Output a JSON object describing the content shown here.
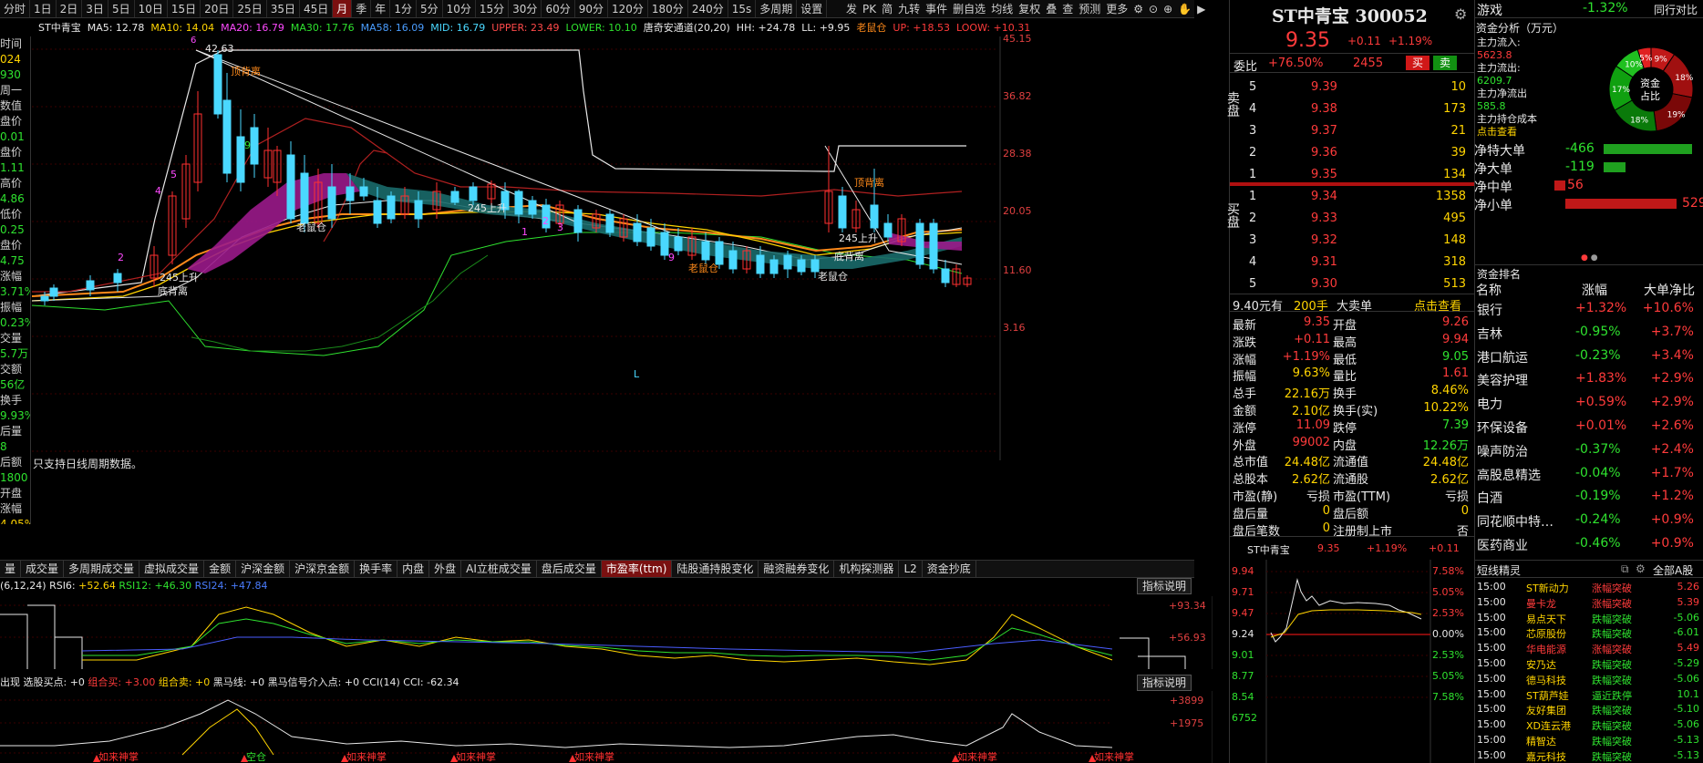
{
  "toolbar": {
    "periods": [
      "分时",
      "1日",
      "2日",
      "3日",
      "5日",
      "10日",
      "15日",
      "20日",
      "25日",
      "35日",
      "45日",
      "月",
      "季",
      "年",
      "1分",
      "5分",
      "10分",
      "15分",
      "30分",
      "60分",
      "90分",
      "120分",
      "180分",
      "240分",
      "15s",
      "多周期",
      "设置"
    ],
    "active_period": "月",
    "right_buttons": [
      "发",
      "PK",
      "简",
      "九转",
      "事件",
      "删自选",
      "均线",
      "复权",
      "叠",
      "查",
      "预测",
      "更多"
    ]
  },
  "ma_line": {
    "stock": "ST中青宝",
    "items": [
      {
        "text": "MA5: 12.78",
        "color": "#e8e8e8"
      },
      {
        "text": "MA10: 14.04",
        "color": "#ffd400"
      },
      {
        "text": "MA20: 16.79",
        "color": "#ff4aff"
      },
      {
        "text": "MA30: 17.76",
        "color": "#2fe22f"
      },
      {
        "text": "MA58: 16.09",
        "color": "#4a9dff"
      },
      {
        "text": "MID: 16.79",
        "color": "#4ad8ff"
      },
      {
        "text": "UPPER: 23.49",
        "color": "#ff4a4a"
      },
      {
        "text": "LOWER: 10.10",
        "color": "#2fe22f"
      },
      {
        "text": "唐奇安通道(20,20)",
        "color": "#e8e8e8"
      },
      {
        "text": "HH: +24.78",
        "color": "#e8e8e8"
      },
      {
        "text": "LL: +9.95",
        "color": "#e8e8e8"
      },
      {
        "text": "老鼠仓",
        "color": "#ff8a1a"
      },
      {
        "text": "UP: +18.53",
        "color": "#ff3b3b"
      },
      {
        "text": "LOOW: +10.31",
        "color": "#ff3b3b"
      }
    ]
  },
  "left_info": [
    "时间",
    "024",
    "930",
    "周一",
    "数值",
    "盘价",
    "0.01",
    "盘价",
    "1.11",
    "高价",
    "4.86",
    "低价",
    "0.25",
    "盘价",
    "4.75",
    "涨幅",
    "3.71%",
    "振幅",
    "0.23%",
    "交量",
    "5.7万",
    "交额",
    "56亿",
    "换手",
    "9.93%",
    "后量",
    "8",
    "后额",
    "1800",
    "开盘",
    "涨幅",
    "4.05%"
  ],
  "price_axis": [
    "45.15",
    "36.82",
    "28.38",
    "20.05",
    "11.60",
    "3.16"
  ],
  "annotations": {
    "high": "42.63",
    "peak_num": "6",
    "note": "只支持日线周期数据。",
    "labels": [
      "顶背离",
      "老鼠仓",
      "底背离",
      "顶背离",
      "老鼠仓",
      "底背离",
      "老鼠仓",
      "245上升",
      "245上升",
      "245上升",
      "L"
    ],
    "nums": [
      "5",
      "4",
      "9",
      "2",
      "1",
      "3",
      "9",
      "2"
    ]
  },
  "bottom_tabs": [
    "量",
    "成交量",
    "多周期成交量",
    "虚拟成交量",
    "金额",
    "沪深金额",
    "沪深京金额",
    "换手率",
    "内盘",
    "外盘",
    "AI立桩成交量",
    "盘后成交量",
    "市盈率(ttm)",
    "陆股通持股变化",
    "融资融券变化",
    "机构探测器",
    "L2",
    "资金抄底"
  ],
  "active_tab": "市盈率(ttm)",
  "rsi": {
    "label": "(6,12,24) RSI6:",
    "rsi6": "+52.64",
    "rsi12_label": "RSI12:",
    "rsi12": "+46.30",
    "rsi24_label": "RSI24:",
    "rsi24": "+47.84",
    "explain_btn": "指标说明",
    "axis": [
      "+93.34",
      "+56.93"
    ]
  },
  "cci": {
    "prefix": "出现",
    "items": [
      {
        "text": "选股买点: +0",
        "color": "#e8e8e8"
      },
      {
        "text": "组合买: +3.00",
        "color": "#ff3b3b"
      },
      {
        "text": "组合卖: +0",
        "color": "#ffd400"
      },
      {
        "text": "黑马线: +0",
        "color": "#e8e8e8"
      },
      {
        "text": "黑马信号介入点: +0",
        "color": "#e8e8e8"
      },
      {
        "text": "CCI(14) CCI: -62.34",
        "color": "#e8e8e8"
      }
    ],
    "explain_btn": "指标说明",
    "axis": [
      "+3899",
      "+1975"
    ],
    "signals": [
      "如来神掌",
      "空仓",
      "如来神掌",
      "如来神掌",
      "如来神掌",
      "如来神掌",
      "如来神掌"
    ]
  },
  "quote": {
    "name": "ST中青宝",
    "code": "300052",
    "price": "9.35",
    "change": "+0.11",
    "change_pct": "+1.19%",
    "weibi_label": "委比",
    "weibi": "+76.50%",
    "weicha": "2455",
    "buy_btn": "买",
    "sell_btn": "卖",
    "sell_label": "卖盘",
    "buy_label": "买盘",
    "sells": [
      {
        "lvl": "5",
        "price": "9.39",
        "vol": "10"
      },
      {
        "lvl": "4",
        "price": "9.38",
        "vol": "173"
      },
      {
        "lvl": "3",
        "price": "9.37",
        "vol": "21"
      },
      {
        "lvl": "2",
        "price": "9.36",
        "vol": "39"
      },
      {
        "lvl": "1",
        "price": "9.35",
        "vol": "134"
      }
    ],
    "buys": [
      {
        "lvl": "1",
        "price": "9.34",
        "vol": "1358"
      },
      {
        "lvl": "2",
        "price": "9.33",
        "vol": "495"
      },
      {
        "lvl": "3",
        "price": "9.32",
        "vol": "148"
      },
      {
        "lvl": "4",
        "price": "9.31",
        "vol": "318"
      },
      {
        "lvl": "5",
        "price": "9.30",
        "vol": "513"
      }
    ],
    "big_order": {
      "price": "9.40元有",
      "qty": "200手",
      "label": "大卖单",
      "link": "点击查看"
    }
  },
  "stats": [
    {
      "l1": "最新",
      "v1": "9.35",
      "c1": "#ff3b3b",
      "l2": "开盘",
      "v2": "9.26",
      "c2": "#ff3b3b"
    },
    {
      "l1": "涨跌",
      "v1": "+0.11",
      "c1": "#ff3b3b",
      "l2": "最高",
      "v2": "9.94",
      "c2": "#ff3b3b"
    },
    {
      "l1": "涨幅",
      "v1": "+1.19%",
      "c1": "#ff3b3b",
      "l2": "最低",
      "v2": "9.05",
      "c2": "#2fe22f"
    },
    {
      "l1": "振幅",
      "v1": "9.63%",
      "c1": "#ffd400",
      "l2": "量比",
      "v2": "1.61",
      "c2": "#ff3b3b"
    },
    {
      "l1": "总手",
      "v1": "22.16万",
      "c1": "#ffd400",
      "l2": "换手",
      "v2": "8.46%",
      "c2": "#ffd400"
    },
    {
      "l1": "金额",
      "v1": "2.10亿",
      "c1": "#ffd400",
      "l2": "换手(实)",
      "v2": "10.22%",
      "c2": "#ffd400"
    },
    {
      "l1": "涨停",
      "v1": "11.09",
      "c1": "#ff3b3b",
      "l2": "跌停",
      "v2": "7.39",
      "c2": "#2fe22f"
    },
    {
      "l1": "外盘",
      "v1": "99002",
      "c1": "#ff3b3b",
      "l2": "内盘",
      "v2": "12.26万",
      "c2": "#2fe22f"
    },
    {
      "l1": "总市值",
      "v1": "24.48亿",
      "c1": "#ffd400",
      "l2": "流通值",
      "v2": "24.48亿",
      "c2": "#ffd400"
    },
    {
      "l1": "总股本",
      "v1": "2.62亿",
      "c1": "#ffd400",
      "l2": "流通股",
      "v2": "2.62亿",
      "c2": "#ffd400"
    },
    {
      "l1": "市盈(静)",
      "v1": "亏损",
      "c1": "#e8e8e8",
      "l2": "市盈(TTM)",
      "v2": "亏损",
      "c2": "#e8e8e8"
    },
    {
      "l1": "盘后量",
      "v1": "0",
      "c1": "#ffd400",
      "l2": "盘后额",
      "v2": "0",
      "c2": "#ffd400"
    },
    {
      "l1": "盘后笔数",
      "v1": "0",
      "c1": "#ffd400",
      "l2": "注册制上市",
      "v2": "否",
      "c2": "#e8e8e8"
    }
  ],
  "mini_chart": {
    "name": "ST中青宝",
    "price": "9.35",
    "pct": "+1.19%",
    "chg": "+0.11",
    "left_axis": [
      "9.94",
      "9.71",
      "9.47",
      "9.24",
      "9.01",
      "8.77",
      "8.54",
      "6752"
    ],
    "right_axis": [
      "7.58%",
      "5.05%",
      "2.53%",
      "0.00%",
      "2.53%",
      "5.05%",
      "7.58%"
    ]
  },
  "sector": {
    "name": "游戏",
    "pct": "-1.32%",
    "button": "同行对比",
    "fund_title": "资金分析（万元）",
    "inflow_label": "主力流入:",
    "inflow": "5623.8",
    "outflow_label": "主力流出:",
    "outflow": "6209.7",
    "net_label": "主力净流出",
    "net": "585.8",
    "cost_label": "主力持仓成本",
    "cost_link": "点击查看",
    "donut_center": [
      "资金",
      "占比"
    ],
    "donut": [
      {
        "label": "9%",
        "value": 9,
        "color": "#c11818"
      },
      {
        "label": "18%",
        "value": 18,
        "color": "#a01010"
      },
      {
        "label": "19%",
        "value": 19,
        "color": "#7a0808"
      },
      {
        "label": "18%",
        "value": 18,
        "color": "#0a7a0a"
      },
      {
        "label": "17%",
        "value": 17,
        "color": "#10a010"
      },
      {
        "label": "10%",
        "value": 10,
        "color": "#20c020"
      },
      {
        "label": "5%",
        "value": 5,
        "color": "#e02020"
      }
    ],
    "flows": [
      {
        "label": "净特大单",
        "value": "-466",
        "color": "#2fe22f",
        "frac": 0.88
      },
      {
        "label": "净大单",
        "value": "-119",
        "color": "#2fe22f",
        "frac": 0.22
      },
      {
        "label": "净中单",
        "value": "56",
        "color": "#ff3b3b",
        "frac": 0.11
      },
      {
        "label": "净小单",
        "value": "529",
        "color": "#ff3b3b",
        "frac": 1.0
      }
    ]
  },
  "ranking": {
    "title": "资金排名",
    "headers": [
      "名称",
      "涨幅",
      "大单净比"
    ],
    "rows": [
      {
        "name": "银行",
        "pct": "+1.32%",
        "net": "+10.6%"
      },
      {
        "name": "吉林",
        "pct": "-0.95%",
        "net": "+3.7%"
      },
      {
        "name": "港口航运",
        "pct": "-0.23%",
        "net": "+3.4%"
      },
      {
        "name": "美容护理",
        "pct": "+1.83%",
        "net": "+2.9%"
      },
      {
        "name": "电力",
        "pct": "+0.59%",
        "net": "+2.9%"
      },
      {
        "name": "环保设备",
        "pct": "+0.01%",
        "net": "+2.6%"
      },
      {
        "name": "噪声防治",
        "pct": "-0.37%",
        "net": "+2.4%"
      },
      {
        "name": "高股息精选",
        "pct": "-0.04%",
        "net": "+1.7%"
      },
      {
        "name": "白酒",
        "pct": "-0.19%",
        "net": "+1.2%"
      },
      {
        "name": "同花顺中特…",
        "pct": "-0.24%",
        "net": "+0.9%"
      },
      {
        "name": "医药商业",
        "pct": "-0.46%",
        "net": "+0.9%"
      }
    ]
  },
  "news": {
    "title": "短线精灵",
    "filter": "全部A股",
    "rows": [
      {
        "time": "15:00",
        "name": "ST新动力",
        "event": "涨幅突破",
        "val": "5.26",
        "color": "#ff3b3b"
      },
      {
        "time": "15:00",
        "name": "曼卡龙",
        "event": "涨幅突破",
        "val": "5.39",
        "color": "#ff3b3b"
      },
      {
        "time": "15:00",
        "name": "易点天下",
        "event": "跌幅突破",
        "val": "-5.06",
        "color": "#2fe22f"
      },
      {
        "time": "15:00",
        "name": "芯原股份",
        "event": "跌幅突破",
        "val": "-6.01",
        "color": "#2fe22f"
      },
      {
        "time": "15:00",
        "name": "华电能源",
        "event": "涨幅突破",
        "val": "5.49",
        "color": "#ff3b3b"
      },
      {
        "time": "15:00",
        "name": "安乃达",
        "event": "跌幅突破",
        "val": "-5.29",
        "color": "#2fe22f"
      },
      {
        "time": "15:00",
        "name": "德马科技",
        "event": "跌幅突破",
        "val": "-5.06",
        "color": "#2fe22f"
      },
      {
        "time": "15:00",
        "name": "ST葫芦娃",
        "event": "逼近跌停",
        "val": "10.1",
        "color": "#2fe22f"
      },
      {
        "time": "15:00",
        "name": "友好集团",
        "event": "跌幅突破",
        "val": "-5.10",
        "color": "#2fe22f"
      },
      {
        "time": "15:00",
        "name": "XD连云港",
        "event": "跌幅突破",
        "val": "-5.06",
        "color": "#2fe22f"
      },
      {
        "time": "15:00",
        "name": "精智达",
        "event": "跌幅突破",
        "val": "-5.13",
        "color": "#2fe22f"
      },
      {
        "time": "15:00",
        "name": "嘉元科技",
        "event": "跌幅突破",
        "val": "-5.13",
        "color": "#2fe22f"
      }
    ]
  }
}
